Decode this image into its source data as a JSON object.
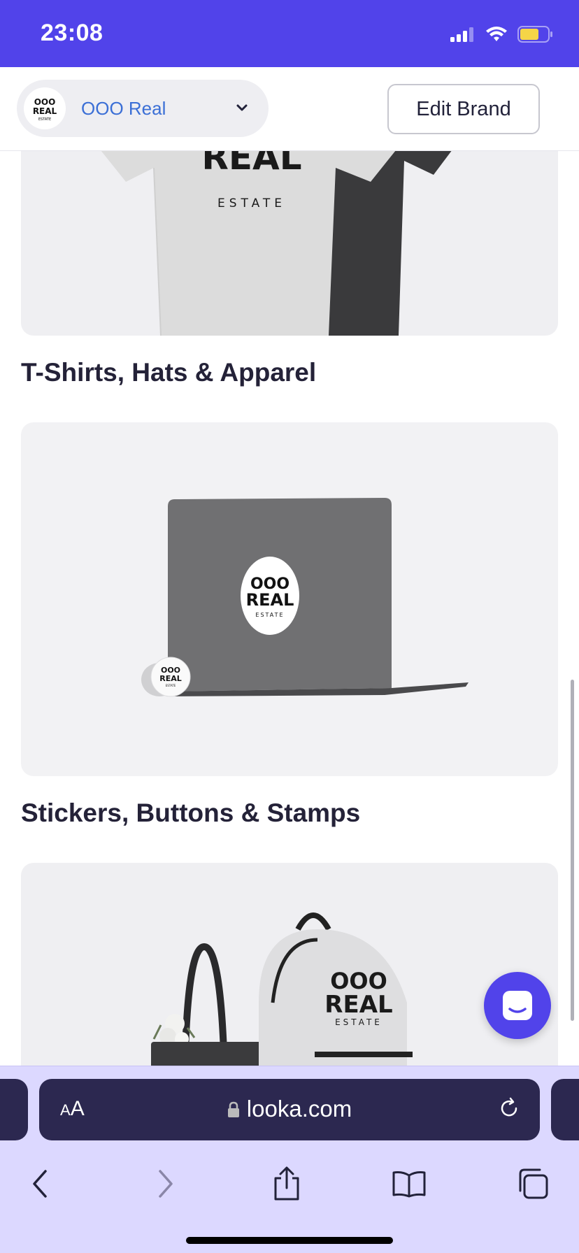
{
  "status_bar": {
    "time": "23:08"
  },
  "brand": {
    "name": "OOO Real",
    "logo_line1": "OOO",
    "logo_line2": "REAL",
    "logo_line3": "ESTATE",
    "edit_label": "Edit Brand"
  },
  "logo_text": {
    "line1": "OOO",
    "line2": "REAL",
    "line3": "ESTATE"
  },
  "sections": [
    {
      "title": "T-Shirts, Hats & Apparel"
    },
    {
      "title": "Stickers, Buttons & Stamps"
    }
  ],
  "browser": {
    "aa_small": "A",
    "aa_large": "A",
    "url": "looka.com"
  },
  "colors": {
    "accent": "#5143ea",
    "link": "#3b6fd6",
    "browser_bg": "#dcd8ff",
    "url_bar": "#2c2850"
  }
}
